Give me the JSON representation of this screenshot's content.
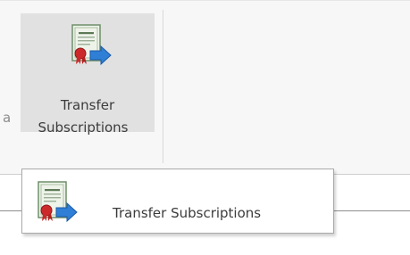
{
  "ribbon": {
    "left_fragment": "a",
    "button": {
      "label_line1": "Transfer",
      "label_line2": "Subscriptions",
      "icon": "certificate-transfer-icon"
    }
  },
  "tooltip": {
    "text": "Transfer Subscriptions",
    "icon": "certificate-transfer-icon"
  },
  "colors": {
    "button_hover_bg": "#e1e1e1",
    "ribbon_bg": "#f7f7f7",
    "arrow_blue": "#2f7fd6",
    "seal_red": "#cc2a2a"
  }
}
